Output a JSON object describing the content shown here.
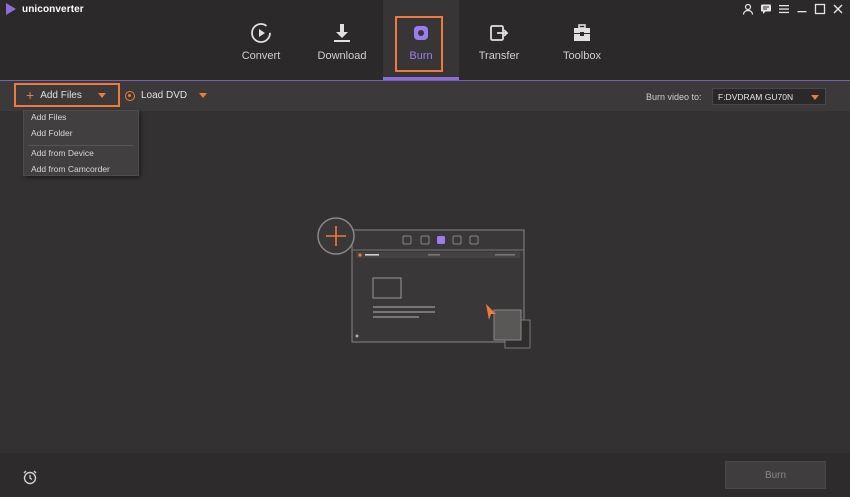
{
  "app": {
    "name": "uniconverter"
  },
  "nav": {
    "items": [
      {
        "label": "Convert",
        "icon": "convert-icon"
      },
      {
        "label": "Download",
        "icon": "download-icon"
      },
      {
        "label": "Burn",
        "icon": "burn-icon",
        "active": true
      },
      {
        "label": "Transfer",
        "icon": "transfer-icon"
      },
      {
        "label": "Toolbox",
        "icon": "toolbox-icon"
      }
    ]
  },
  "toolbar": {
    "add_files": "Add Files",
    "load_dvd": "Load DVD",
    "burn_to_label": "Burn video to:",
    "burn_target": "F:DVDRAM GU70N"
  },
  "dropdown": {
    "items": [
      "Add Files",
      "Add Folder",
      "Add from Device",
      "Add from Camcorder"
    ]
  },
  "footer": {
    "burn_button": "Burn"
  },
  "colors": {
    "accent": "#8b6fd6",
    "highlight": "#f07a3b",
    "background": "#333131"
  }
}
